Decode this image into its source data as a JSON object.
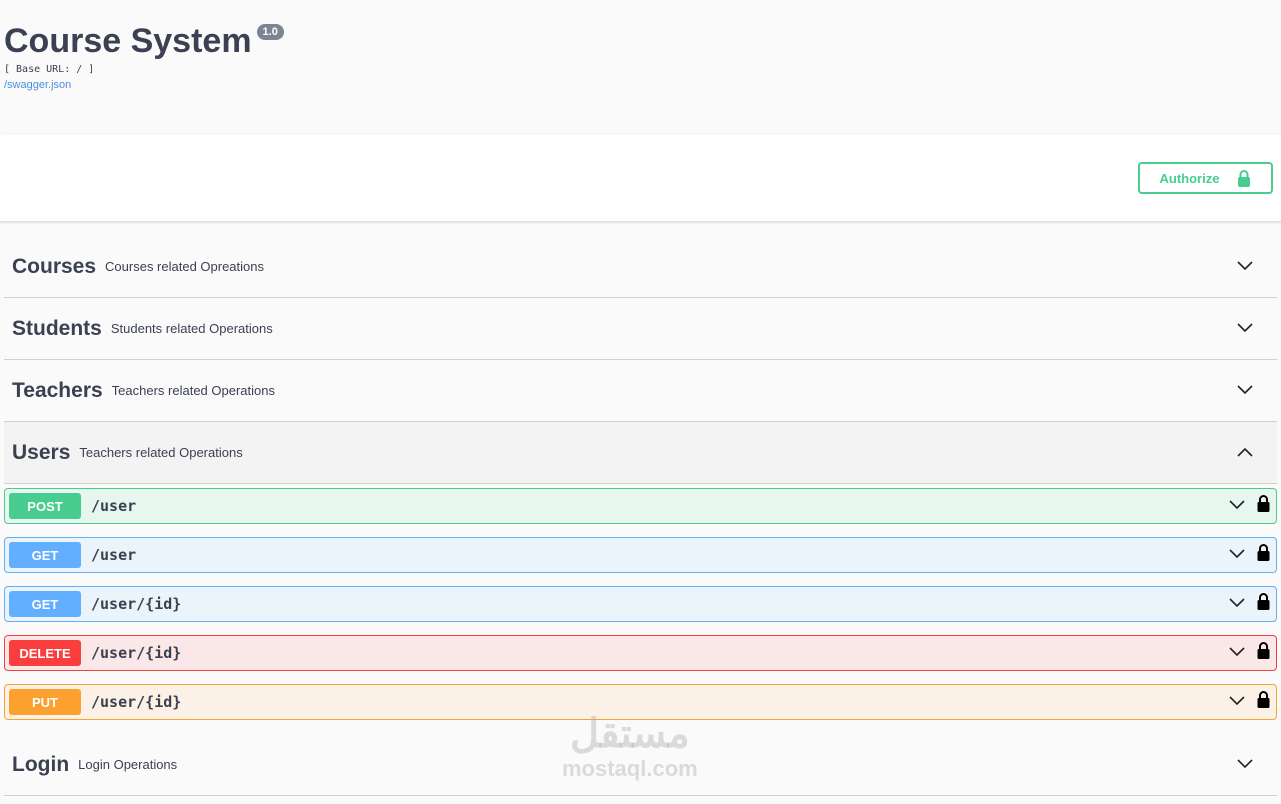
{
  "info": {
    "title": "Course System",
    "version": "1.0",
    "base_url": "[ Base URL: / ]",
    "spec_link": "/swagger.json"
  },
  "authorize": {
    "label": "Authorize",
    "icon": "lock-icon"
  },
  "colors": {
    "post": "#49cc90",
    "get": "#61affe",
    "delete": "#f93e3e",
    "put": "#fca130"
  },
  "tags": [
    {
      "name": "Courses",
      "description": "Courses related Opreations",
      "expanded": false
    },
    {
      "name": "Students",
      "description": "Students related Operations",
      "expanded": false
    },
    {
      "name": "Teachers",
      "description": "Teachers related Operations",
      "expanded": false
    },
    {
      "name": "Users",
      "description": "Teachers related Operations",
      "expanded": true
    },
    {
      "name": "Login",
      "description": "Login Operations",
      "expanded": false
    }
  ],
  "operations": [
    {
      "method": "POST",
      "path": "/user"
    },
    {
      "method": "GET",
      "path": "/user"
    },
    {
      "method": "GET",
      "path": "/user/{id}"
    },
    {
      "method": "DELETE",
      "path": "/user/{id}"
    },
    {
      "method": "PUT",
      "path": "/user/{id}"
    }
  ],
  "watermark": {
    "arabic": "مستقل",
    "latin": "mostaql.com"
  }
}
